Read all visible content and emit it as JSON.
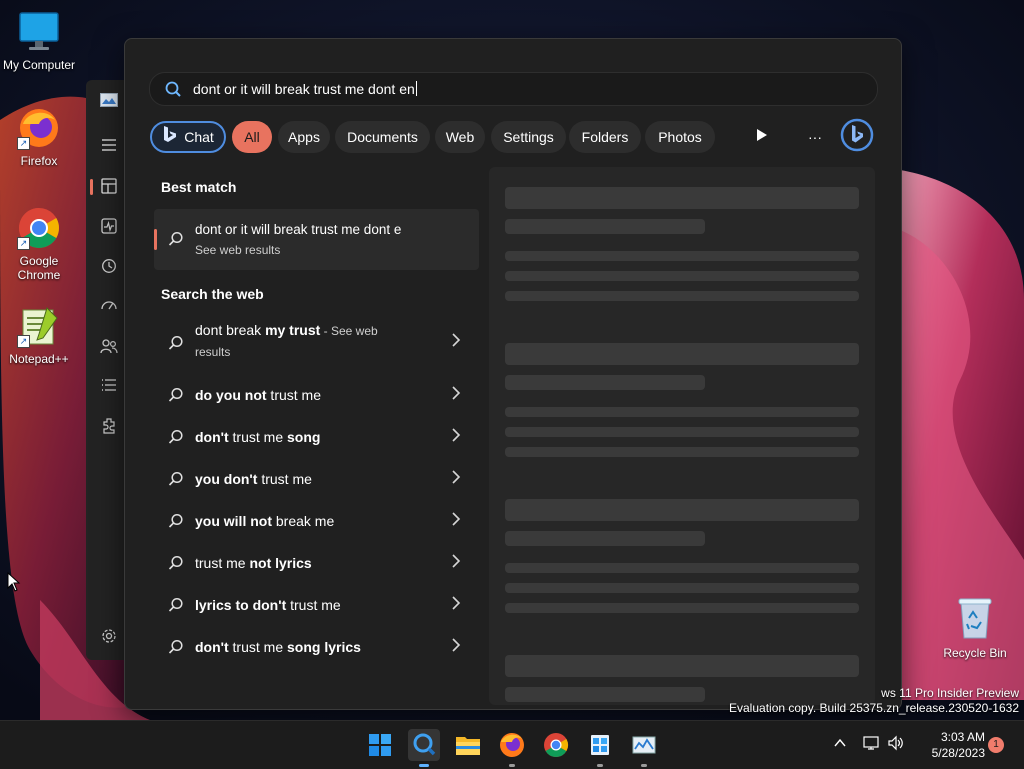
{
  "desktop": {
    "icons": [
      {
        "label": "My Computer",
        "icon": "monitor-icon"
      },
      {
        "label": "Firefox",
        "icon": "firefox-icon"
      },
      {
        "label": "Google Chrome",
        "icon": "chrome-icon"
      },
      {
        "label": "Notepad++",
        "icon": "notepadpp-icon"
      }
    ],
    "recycle_bin": "Recycle Bin",
    "watermark": {
      "line1": "ws 11 Pro Insider Preview",
      "line2": "Evaluation copy. Build 25375.zn_release.230520-1632"
    }
  },
  "search": {
    "query": "dont or it will break trust me dont en",
    "filters": {
      "chat": "Chat",
      "all": "All",
      "apps": "Apps",
      "documents": "Documents",
      "web": "Web",
      "settings": "Settings",
      "folders": "Folders",
      "photos": "Photos",
      "more": "···"
    },
    "best_match_heading": "Best match",
    "best_match": {
      "title": "dont or it will break trust me dont e",
      "subtitle": "See web results"
    },
    "web_heading": "Search the web",
    "web_results": [
      {
        "parts": [
          [
            "dont break ",
            false
          ],
          [
            "my trust",
            true
          ]
        ],
        "suffix": " - See web",
        "suffix2": "results"
      },
      {
        "parts": [
          [
            "do you not",
            true
          ],
          [
            " trust me",
            false
          ]
        ]
      },
      {
        "parts": [
          [
            "don't",
            true
          ],
          [
            " trust me ",
            false
          ],
          [
            "song",
            true
          ]
        ]
      },
      {
        "parts": [
          [
            "you don't",
            true
          ],
          [
            " trust me",
            false
          ]
        ]
      },
      {
        "parts": [
          [
            "you will not",
            true
          ],
          [
            " break me",
            false
          ]
        ]
      },
      {
        "parts": [
          [
            "trust me ",
            false
          ],
          [
            "not lyrics",
            true
          ]
        ]
      },
      {
        "parts": [
          [
            "lyrics to don't",
            true
          ],
          [
            " trust me",
            false
          ]
        ]
      },
      {
        "parts": [
          [
            "don't",
            true
          ],
          [
            " trust me ",
            false
          ],
          [
            "song lyrics",
            true
          ]
        ]
      }
    ]
  },
  "taskbar": {
    "time": "3:03 AM",
    "date": "5/28/2023",
    "notification_count": "1",
    "apps": [
      "start-icon",
      "search-icon",
      "file-explorer-icon",
      "firefox-icon",
      "chrome-icon",
      "widgets-icon",
      "task-manager-icon"
    ]
  },
  "colors": {
    "accent": "#e8735f",
    "bing_blue": "#4f8de0"
  }
}
